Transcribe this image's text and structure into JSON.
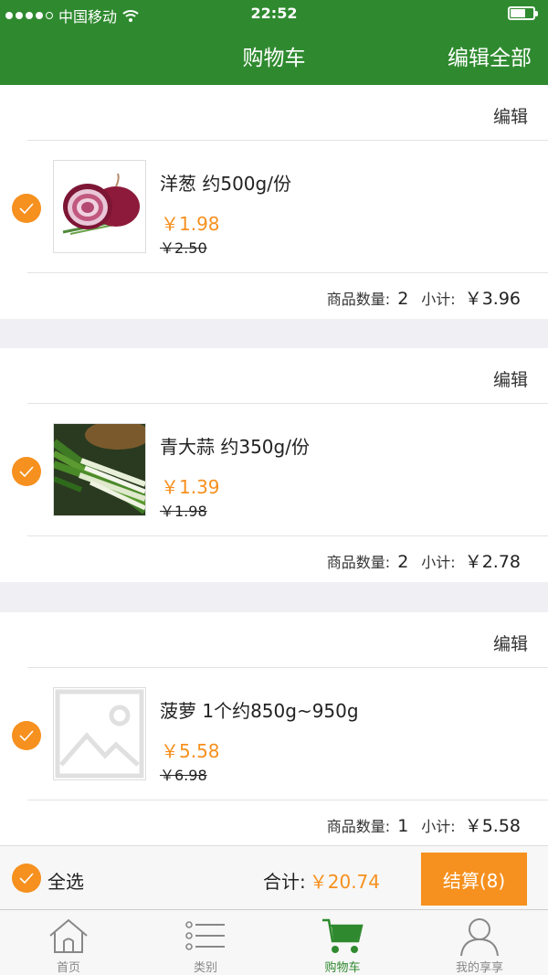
{
  "status_bar": {
    "carrier": "中国移动",
    "time": "22:52"
  },
  "header": {
    "title": "购物车",
    "edit_all": "编辑全部"
  },
  "cart": {
    "edit_label": "编辑",
    "qty_label": "商品数量:",
    "subtotal_label": "小计:",
    "items": [
      {
        "name": "洋葱 约500g/份",
        "price": "￥1.98",
        "original_price": "￥2.50",
        "quantity": "2",
        "subtotal": "￥3.96",
        "image": "onion-image",
        "checked": true
      },
      {
        "name": "青大蒜 约350g/份",
        "price": "￥1.39",
        "original_price": "￥1.98",
        "quantity": "2",
        "subtotal": "￥2.78",
        "image": "green-garlic-image",
        "checked": true
      },
      {
        "name": "菠萝 1个约850g~950g",
        "price": "￥5.58",
        "original_price": "￥6.98",
        "quantity": "1",
        "subtotal": "￥5.58",
        "image": "placeholder-image",
        "checked": true
      }
    ]
  },
  "checkout": {
    "select_all": "全选",
    "total_label": "合计:",
    "total": "￥20.74",
    "pay_button": "结算(8)"
  },
  "tabbar": {
    "tabs": [
      {
        "label": "首页",
        "icon": "home-icon"
      },
      {
        "label": "类别",
        "icon": "list-icon"
      },
      {
        "label": "购物车",
        "icon": "cart-icon",
        "active": true
      },
      {
        "label": "我的享享",
        "icon": "user-icon"
      }
    ]
  },
  "colors": {
    "header_green": "#2f8a2f",
    "accent_orange": "#f6901e"
  }
}
